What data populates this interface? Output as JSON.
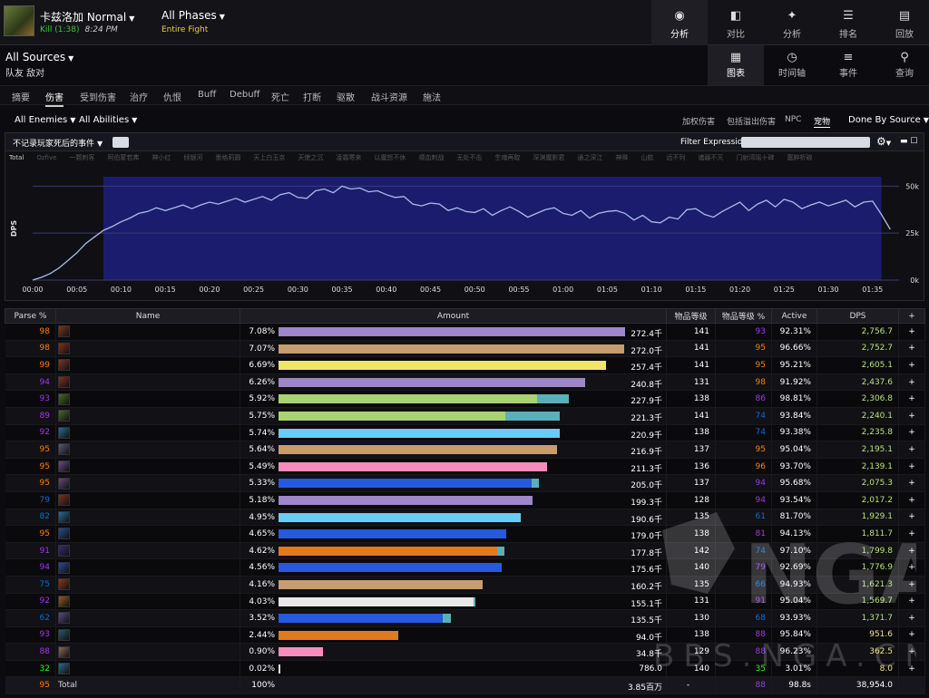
{
  "header": {
    "boss_name": "卡兹洛加 Normal",
    "result": "Kill (1:38)",
    "time": "8:24 PM",
    "phase": "All Phases",
    "phase_sub": "Entire Fight",
    "nav": [
      {
        "label": "分析",
        "icon": "eye-icon",
        "glyph": "◉",
        "active": true
      },
      {
        "label": "对比",
        "icon": "compare-icon",
        "glyph": "◧",
        "active": false
      },
      {
        "label": "分析",
        "icon": "puzzle-icon",
        "glyph": "✦",
        "active": false
      },
      {
        "label": "排名",
        "icon": "ranking-icon",
        "glyph": "☰",
        "active": false
      },
      {
        "label": "回放",
        "icon": "replay-icon",
        "glyph": "▤",
        "active": false
      }
    ]
  },
  "source": {
    "title": "All Sources",
    "subtitle": "队友  敌对",
    "views": [
      {
        "label": "图表",
        "icon": "table-icon",
        "glyph": "▦",
        "active": true
      },
      {
        "label": "时间轴",
        "icon": "clock-icon",
        "glyph": "◷",
        "active": false
      },
      {
        "label": "事件",
        "icon": "list-icon",
        "glyph": "≡",
        "active": false
      },
      {
        "label": "查询",
        "icon": "pin-icon",
        "glyph": "⚲",
        "active": false
      }
    ]
  },
  "tabs": [
    "摘要",
    "伤害",
    "受到伤害",
    "治疗",
    "仇恨",
    "Buff",
    "Debuff",
    "死亡",
    "打断",
    "驱散",
    "战斗资源",
    "施法"
  ],
  "active_tab": 1,
  "filters": {
    "enemies": "All Enemies",
    "abilities": "All Abilities",
    "options": [
      "加权伤害",
      "包括溢出伤害",
      "NPC",
      "宠物"
    ],
    "active_option": 3,
    "group": "Done By Source"
  },
  "chart_header": {
    "dead_events": "不记录玩家死后的事件",
    "filter_label": "Filter Expression:"
  },
  "legend": [
    "Total",
    "Ozfive",
    "一颗刺客",
    "阿伯蒙若弗",
    "神小红",
    "倾银河",
    "墨格莉圆",
    "天上白玉京",
    "天使之沉",
    "凌霜寒来",
    "以魔怒不休",
    "顺血刺战",
    "无处不击",
    "生魂再取",
    "深渊魔影君",
    "通之深江",
    "神殊",
    "山航",
    "远不列",
    "诸疆不灭",
    "门射湾瑶十碑",
    "塞肿析碗"
  ],
  "chart_data": {
    "type": "line",
    "title": "",
    "xlabel": "",
    "ylabel": "DPS",
    "x_ticks": [
      "00:00",
      "00:05",
      "00:10",
      "00:15",
      "00:20",
      "00:25",
      "00:30",
      "00:35",
      "00:40",
      "00:45",
      "00:50",
      "00:55",
      "01:00",
      "01:05",
      "01:10",
      "01:15",
      "01:20",
      "01:25",
      "01:30",
      "01:35"
    ],
    "y_ticks": [
      "50k",
      "25k",
      "0k"
    ],
    "ylim": [
      0,
      55000
    ],
    "xlim": [
      0,
      98
    ],
    "highlight_range": [
      8,
      96
    ],
    "series": [
      {
        "name": "Total",
        "color": "#a9bde8",
        "x": [
          0,
          1,
          2,
          3,
          4,
          5,
          6,
          7,
          8,
          9,
          10,
          11,
          12,
          13,
          14,
          15,
          16,
          17,
          18,
          19,
          20,
          21,
          22,
          23,
          24,
          25,
          26,
          27,
          28,
          29,
          30,
          31,
          32,
          33,
          34,
          35,
          36,
          37,
          38,
          39,
          40,
          41,
          42,
          43,
          44,
          45,
          46,
          47,
          48,
          49,
          50,
          51,
          52,
          53,
          54,
          55,
          56,
          57,
          58,
          59,
          60,
          61,
          62,
          63,
          64,
          65,
          66,
          67,
          68,
          69,
          70,
          71,
          72,
          73,
          74,
          75,
          76,
          77,
          78,
          79,
          80,
          81,
          82,
          83,
          84,
          85,
          86,
          87,
          88,
          89,
          90,
          91,
          92,
          93,
          94,
          95,
          96,
          97
        ],
        "y": [
          0,
          1500,
          3500,
          6500,
          10500,
          14500,
          19500,
          23000,
          26500,
          28500,
          31000,
          33000,
          35500,
          36500,
          38500,
          37000,
          38500,
          40000,
          38000,
          40000,
          41500,
          40500,
          42000,
          43500,
          41500,
          43000,
          44500,
          42500,
          45500,
          46500,
          44000,
          43500,
          47500,
          48500,
          46500,
          50000,
          48500,
          49000,
          47000,
          47500,
          45500,
          44000,
          44500,
          40500,
          39500,
          41000,
          40500,
          37000,
          38500,
          36500,
          36000,
          38000,
          34500,
          37000,
          39000,
          36500,
          33500,
          35500,
          37500,
          38500,
          35500,
          34500,
          37000,
          33000,
          35500,
          36500,
          37000,
          35500,
          32000,
          34500,
          31000,
          30500,
          33500,
          32500,
          37500,
          38000,
          35000,
          33500,
          36500,
          39000,
          41500,
          37000,
          40500,
          42500,
          39000,
          43000,
          41500,
          38000,
          40000,
          41500,
          39500,
          41000,
          42500,
          39000,
          41500,
          42000,
          35000,
          27000
        ]
      }
    ]
  },
  "table": {
    "headers": [
      "Parse %",
      "Name",
      "Amount",
      "物品等级",
      "物品等级 %",
      "Active",
      "DPS",
      "+"
    ],
    "rows": [
      {
        "parse": "98",
        "parse_color": "#ff8000",
        "icon": "class-spec-icon",
        "icon_color": "#8a2e20",
        "pct": "7.08%",
        "bar": [
          0.98,
          0
        ],
        "color": "#9d86c9",
        "amount": "272.4千",
        "ilvl": "141",
        "ilvlp": "93",
        "ilvlp_color": "#a335ee",
        "active": "92.31%",
        "dps": "2,756.7",
        "dps_color": "#b8e07a"
      },
      {
        "parse": "98",
        "parse_color": "#ff8000",
        "icon": "class-spec-icon",
        "icon_color": "#8a2e20",
        "pct": "7.07%",
        "bar": [
          0.978,
          0
        ],
        "color": "#c79c6e",
        "amount": "272.0千",
        "ilvl": "141",
        "ilvlp": "95",
        "ilvlp_color": "#ff8000",
        "active": "96.66%",
        "dps": "2,752.7",
        "dps_color": "#b8e07a"
      },
      {
        "parse": "99",
        "parse_color": "#ff8000",
        "icon": "class-spec-icon",
        "icon_color": "#7a3a2a",
        "pct": "6.69%",
        "bar": [
          0.926,
          0
        ],
        "color": "#f0e56a",
        "amount": "257.4千",
        "ilvl": "141",
        "ilvlp": "95",
        "ilvlp_color": "#ff8000",
        "active": "95.21%",
        "dps": "2,605.1",
        "dps_color": "#b8e07a"
      },
      {
        "parse": "94",
        "parse_color": "#a335ee",
        "icon": "class-spec-icon",
        "icon_color": "#8a2e20",
        "pct": "6.26%",
        "bar": [
          0.866,
          0
        ],
        "color": "#9d86c9",
        "amount": "240.8千",
        "ilvl": "131",
        "ilvlp": "98",
        "ilvlp_color": "#ff8000",
        "active": "91.92%",
        "dps": "2,437.6",
        "dps_color": "#b8e07a"
      },
      {
        "parse": "93",
        "parse_color": "#a335ee",
        "icon": "class-spec-icon",
        "icon_color": "#4a6a2a",
        "pct": "5.92%",
        "bar": [
          0.73,
          0.09
        ],
        "color": "#a9d271",
        "color2": "#59b0b8",
        "amount": "227.9千",
        "ilvl": "138",
        "ilvlp": "86",
        "ilvlp_color": "#a335ee",
        "active": "98.81%",
        "dps": "2,306.8",
        "dps_color": "#b8e07a"
      },
      {
        "parse": "89",
        "parse_color": "#a335ee",
        "icon": "class-spec-icon",
        "icon_color": "#4a6a2a",
        "pct": "5.75%",
        "bar": [
          0.64,
          0.155
        ],
        "color": "#a9d271",
        "color2": "#59b0b8",
        "amount": "221.3千",
        "ilvl": "141",
        "ilvlp": "74",
        "ilvlp_color": "#0070dd",
        "active": "93.84%",
        "dps": "2,240.1",
        "dps_color": "#b8e07a"
      },
      {
        "parse": "92",
        "parse_color": "#a335ee",
        "icon": "class-spec-icon",
        "icon_color": "#2a6a9a",
        "pct": "5.74%",
        "bar": [
          0.794,
          0
        ],
        "color": "#69ccf0",
        "amount": "220.9千",
        "ilvl": "138",
        "ilvlp": "74",
        "ilvlp_color": "#0070dd",
        "active": "93.38%",
        "dps": "2,235.8",
        "dps_color": "#b8e07a"
      },
      {
        "parse": "95",
        "parse_color": "#ff8000",
        "icon": "class-spec-icon",
        "icon_color": "#5a5a7a",
        "pct": "5.64%",
        "bar": [
          0.788,
          0
        ],
        "color": "#c79c6e",
        "amount": "216.9千",
        "ilvl": "137",
        "ilvlp": "95",
        "ilvlp_color": "#ff8000",
        "active": "95.04%",
        "dps": "2,195.1",
        "dps_color": "#b8e07a"
      },
      {
        "parse": "95",
        "parse_color": "#ff8000",
        "icon": "class-spec-icon",
        "icon_color": "#6a4a8a",
        "pct": "5.49%",
        "bar": [
          0.76,
          0
        ],
        "color": "#f58cba",
        "amount": "211.3千",
        "ilvl": "136",
        "ilvlp": "96",
        "ilvlp_color": "#ff8000",
        "active": "93.70%",
        "dps": "2,139.1",
        "dps_color": "#b8e07a"
      },
      {
        "parse": "95",
        "parse_color": "#ff8000",
        "icon": "class-spec-icon",
        "icon_color": "#6a4a7a",
        "pct": "5.33%",
        "bar": [
          0.715,
          0.022
        ],
        "color": "#2459e0",
        "color2": "#59b0b8",
        "amount": "205.0千",
        "ilvl": "137",
        "ilvlp": "94",
        "ilvlp_color": "#a335ee",
        "active": "95.68%",
        "dps": "2,075.3",
        "dps_color": "#b8e07a"
      },
      {
        "parse": "79",
        "parse_color": "#0070dd",
        "icon": "class-spec-icon",
        "icon_color": "#8a2e20",
        "pct": "5.18%",
        "bar": [
          0.717,
          0
        ],
        "color": "#9d86c9",
        "amount": "199.3千",
        "ilvl": "128",
        "ilvlp": "94",
        "ilvlp_color": "#a335ee",
        "active": "93.54%",
        "dps": "2,017.2",
        "dps_color": "#b8e07a"
      },
      {
        "parse": "82",
        "parse_color": "#0070dd",
        "icon": "class-spec-icon",
        "icon_color": "#2a6a9a",
        "pct": "4.95%",
        "bar": [
          0.685,
          0
        ],
        "color": "#69ccf0",
        "amount": "190.6千",
        "ilvl": "135",
        "ilvlp": "61",
        "ilvlp_color": "#0070dd",
        "active": "81.70%",
        "dps": "1,929.1",
        "dps_color": "#b8e07a"
      },
      {
        "parse": "95",
        "parse_color": "#ff8000",
        "icon": "class-spec-icon",
        "icon_color": "#2a4a9a",
        "pct": "4.65%",
        "bar": [
          0.643,
          0
        ],
        "color": "#2459e0",
        "amount": "179.0千",
        "ilvl": "138",
        "ilvlp": "81",
        "ilvlp_color": "#a335ee",
        "active": "94.13%",
        "dps": "1,811.7",
        "dps_color": "#b8e07a"
      },
      {
        "parse": "91",
        "parse_color": "#a335ee",
        "icon": "class-spec-icon",
        "icon_color": "#3a2a7a",
        "pct": "4.62%",
        "bar": [
          0.618,
          0.02
        ],
        "color": "#e07a1c",
        "color2": "#59b0b8",
        "amount": "177.8千",
        "ilvl": "142",
        "ilvlp": "74",
        "ilvlp_color": "#0070dd",
        "active": "97.10%",
        "dps": "1,799.8",
        "dps_color": "#b8e07a"
      },
      {
        "parse": "94",
        "parse_color": "#a335ee",
        "icon": "class-spec-icon",
        "icon_color": "#2a4a9a",
        "pct": "4.56%",
        "bar": [
          0.631,
          0
        ],
        "color": "#2459e0",
        "amount": "175.6千",
        "ilvl": "140",
        "ilvlp": "79",
        "ilvlp_color": "#a335ee",
        "active": "92.69%",
        "dps": "1,776.9",
        "dps_color": "#b8e07a"
      },
      {
        "parse": "75",
        "parse_color": "#0070dd",
        "icon": "class-spec-icon",
        "icon_color": "#8a3a20",
        "pct": "4.16%",
        "bar": [
          0.576,
          0
        ],
        "color": "#c79c6e",
        "amount": "160.2千",
        "ilvl": "135",
        "ilvlp": "66",
        "ilvlp_color": "#0070dd",
        "active": "94.93%",
        "dps": "1,621.3",
        "dps_color": "#b8e07a"
      },
      {
        "parse": "92",
        "parse_color": "#a335ee",
        "icon": "class-spec-icon",
        "icon_color": "#9a5a20",
        "pct": "4.03%",
        "bar": [
          0.55,
          0.006
        ],
        "color": "#e8e8e8",
        "color2": "#59b0b8",
        "amount": "155.1千",
        "ilvl": "131",
        "ilvlp": "91",
        "ilvlp_color": "#a335ee",
        "active": "95.04%",
        "dps": "1,569.7",
        "dps_color": "#b8e07a"
      },
      {
        "parse": "62",
        "parse_color": "#0070dd",
        "icon": "class-spec-icon",
        "icon_color": "#5a4a8a",
        "pct": "3.52%",
        "bar": [
          0.465,
          0.022
        ],
        "color": "#2459e0",
        "color2": "#59b0b8",
        "amount": "135.5千",
        "ilvl": "130",
        "ilvlp": "68",
        "ilvlp_color": "#0070dd",
        "active": "93.93%",
        "dps": "1,371.7",
        "dps_color": "#b8e07a"
      },
      {
        "parse": "93",
        "parse_color": "#a335ee",
        "icon": "class-spec-icon",
        "icon_color": "#2a5a6a",
        "pct": "2.44%",
        "bar": [
          0.338,
          0
        ],
        "color": "#e07a1c",
        "amount": "94.0千",
        "ilvl": "138",
        "ilvlp": "88",
        "ilvlp_color": "#a335ee",
        "active": "95.84%",
        "dps": "951.6",
        "dps_color": "#f0e090"
      },
      {
        "parse": "88",
        "parse_color": "#a335ee",
        "icon": "class-spec-icon",
        "icon_color": "#8a6a5a",
        "pct": "0.90%",
        "bar": [
          0.125,
          0
        ],
        "color": "#f58cba",
        "amount": "34.8千",
        "ilvl": "129",
        "ilvlp": "88",
        "ilvlp_color": "#a335ee",
        "active": "96.23%",
        "dps": "362.5",
        "dps_color": "#f0e090"
      },
      {
        "parse": "32",
        "parse_color": "#1eff00",
        "icon": "class-spec-icon",
        "icon_color": "#2a6a8a",
        "pct": "0.02%",
        "bar": [
          0.004,
          0
        ],
        "color": "#e8e8e8",
        "amount": "786.0",
        "ilvl": "140",
        "ilvlp": "35",
        "ilvlp_color": "#1eff00",
        "active": "3.01%",
        "dps": "8.0",
        "dps_color": "#f0e090"
      }
    ],
    "total": {
      "parse": "95",
      "name": "Total",
      "pct": "100%",
      "amount": "3.85百万",
      "ilvl": "-",
      "ilvlp": "88",
      "active": "98.8s",
      "dps": "38,954.0"
    }
  }
}
